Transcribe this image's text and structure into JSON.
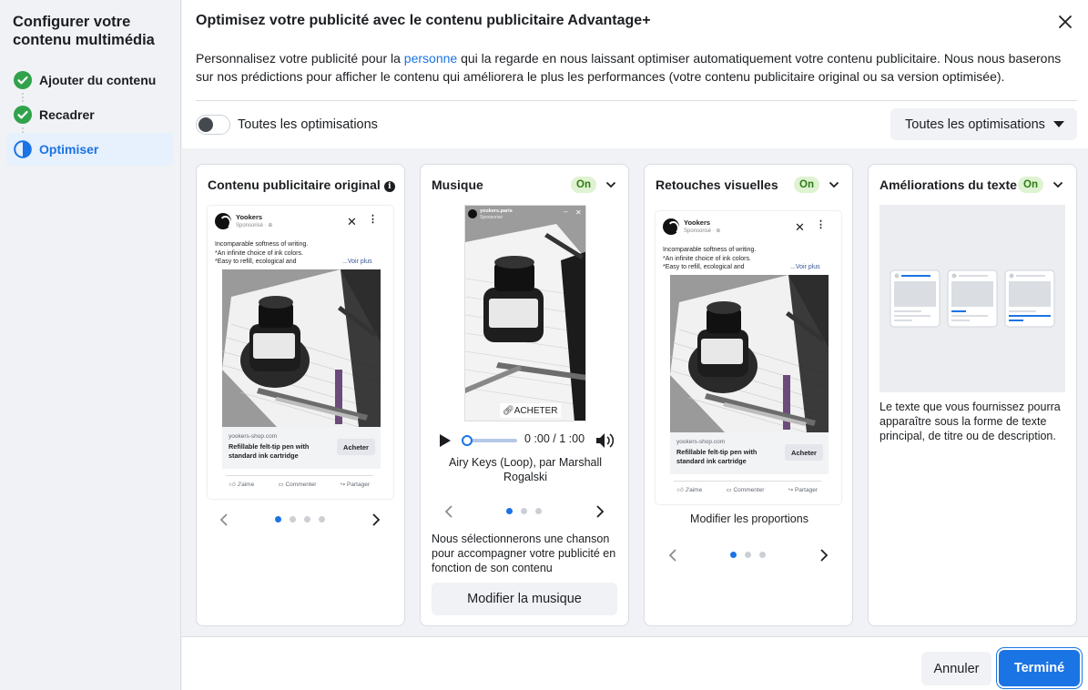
{
  "sidebar": {
    "title": "Configurer votre contenu multimédia",
    "steps": [
      {
        "label": "Ajouter du contenu",
        "status": "done"
      },
      {
        "label": "Recadrer",
        "status": "done"
      },
      {
        "label": "Optimiser",
        "status": "current"
      }
    ]
  },
  "dialog": {
    "title": "Optimisez votre publicité avec le contenu publicitaire Advantage+",
    "desc_before": "Personnalisez votre publicité pour la ",
    "desc_link": "personne",
    "desc_after": " qui la regarde en nous laissant optimiser automatiquement votre contenu publicitaire. Nous nous baserons sur nos prédictions pour afficher le contenu qui améliorera le plus les performances (votre contenu publicitaire original ou sa version optimisée).",
    "toggle_label": "Toutes les optimisations",
    "toggle_on": false,
    "select_value": "Toutes les optimisations"
  },
  "ad": {
    "brand": "Yookers",
    "sponsored": "Sponsorisé · ⊕",
    "text_lines": [
      "Incomparable softness of writing.",
      "*An infinite choice of ink colors.",
      "*Easy to refill, ecological and"
    ],
    "more": "...Voir plus",
    "site": "yookers-shop.com",
    "product_title": "Refillable felt-tip pen with standard ink cartridge",
    "cta": "Acheter",
    "actions": [
      "J'aime",
      "Commenter",
      "Partager"
    ]
  },
  "cards": {
    "original": {
      "title": "Contenu publicitaire original"
    },
    "music": {
      "title": "Musique",
      "badge": "On",
      "story_brand": "yookers.paris",
      "story_spons": "Sponsorisé",
      "story_cta": "ACHETER",
      "time": "0 :00 / 1 :00",
      "song": "Airy Keys (Loop), par Marshall Rogalski",
      "caption": "Nous sélectionnerons une chanson pour accompagner votre publicité en fonction de son contenu",
      "button": "Modifier la musique"
    },
    "visual": {
      "title": "Retouches visuelles",
      "badge": "On",
      "caption": "Modifier les proportions"
    },
    "text": {
      "title": "Améliorations du texte",
      "badge": "On",
      "caption": "Le texte que vous fournissez pourra apparaître sous la forme de texte principal, de titre ou de description."
    }
  },
  "footer": {
    "cancel": "Annuler",
    "done": "Terminé"
  },
  "colors": {
    "accent": "#1b74e4",
    "success": "#31a24c",
    "badge_bg": "#dff2d1"
  }
}
